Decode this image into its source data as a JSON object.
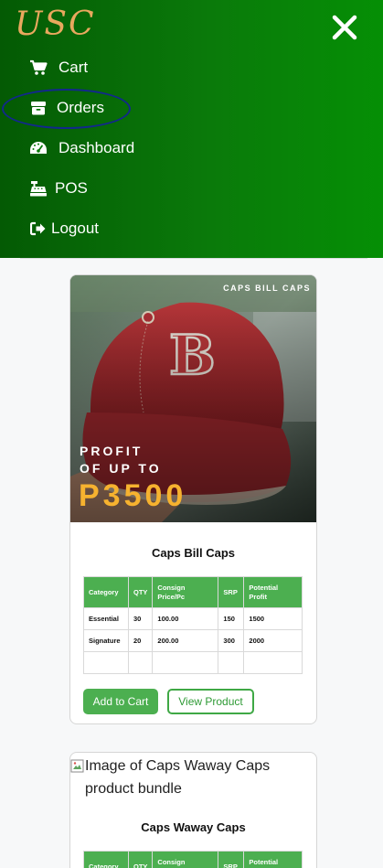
{
  "nav": {
    "brand": "USC",
    "menu": [
      {
        "label": "Cart",
        "icon": "cart-icon"
      },
      {
        "label": "Orders",
        "icon": "box-icon"
      },
      {
        "label": "Dashboard",
        "icon": "gauge-icon"
      },
      {
        "label": "POS",
        "icon": "cash-register-icon"
      },
      {
        "label": "Logout",
        "icon": "sign-out-icon"
      }
    ],
    "close_icon": "close-icon"
  },
  "products": [
    {
      "name": "Caps Bill Caps",
      "image": {
        "tag": "CAPS BILL CAPS",
        "promo_line1": "PROFIT",
        "promo_line2": "OF UP TO",
        "promo_amount": "P3500"
      },
      "table": {
        "headers": [
          "Category",
          "QTY",
          "Consign Price/Pc",
          "SRP",
          "Potential Profit"
        ],
        "rows": [
          [
            "Essential",
            "30",
            "100.00",
            "150",
            "1500"
          ],
          [
            "Signature",
            "20",
            "200.00",
            "300",
            "2000"
          ],
          [
            "",
            "",
            "",
            "",
            ""
          ]
        ]
      },
      "buttons": {
        "add": "Add to Cart",
        "view": "View Product"
      }
    },
    {
      "name": "Caps Waway Caps",
      "image_alt": "Image of Caps Waway Caps product bundle",
      "table": {
        "headers": [
          "Category",
          "QTY",
          "Consign Price/Pc",
          "SRP",
          "Potential Profit"
        ]
      }
    }
  ],
  "colors": {
    "nav_green": "#0a7a0a",
    "brand_orange": "#e9a85e",
    "table_header": "#4caf50",
    "promo_gold": "#f6b22f",
    "highlight_ring": "#12288c"
  }
}
